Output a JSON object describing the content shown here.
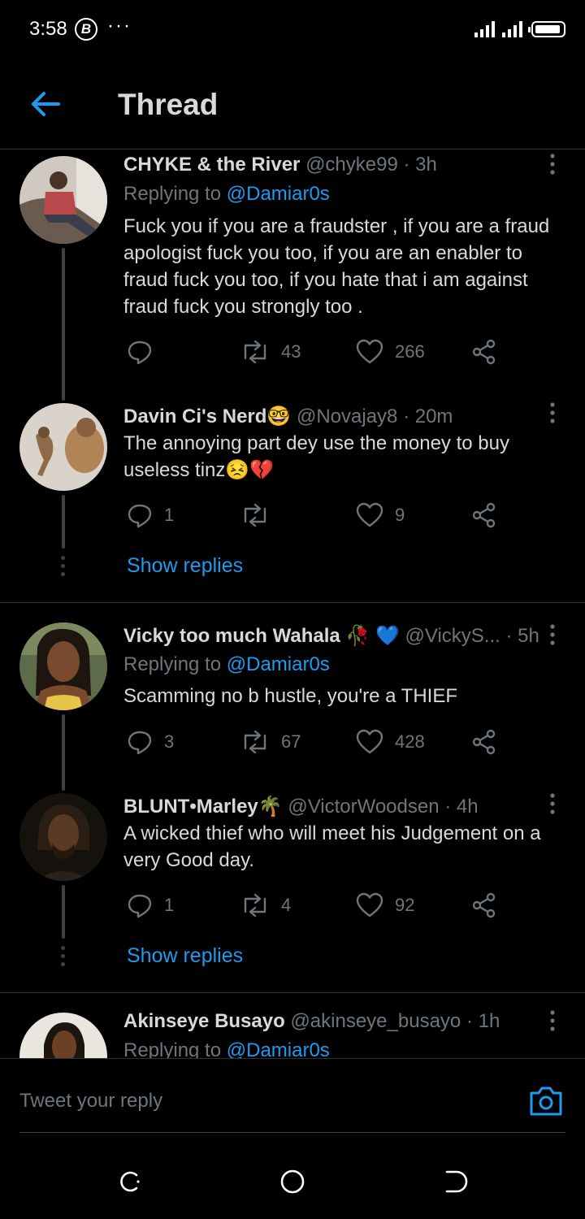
{
  "status_bar": {
    "time": "3:58",
    "app_badge": "B",
    "more": "···"
  },
  "header": {
    "title": "Thread"
  },
  "tweets": [
    {
      "name": "CHYKE & the River",
      "handle": "@chyke99",
      "time": "· 3h",
      "replying_label": "Replying to",
      "replying_to": "@Damiar0s",
      "text": "Fuck you if you are a fraudster , if you are a fraud apologist fuck you too, if you are an enabler to fraud fuck you too, if you hate that i am against fraud fuck you strongly too .",
      "replies": "",
      "retweets": "43",
      "likes": "266"
    },
    {
      "name": "Davin Ci's Nerd🤓",
      "handle": "@Novajay8",
      "time": "· 20m",
      "text": "The annoying part dey use the money to buy useless tinz😣💔",
      "replies": "1",
      "retweets": "",
      "likes": "9",
      "show_replies": "Show replies"
    },
    {
      "name": "Vicky too much Wahala 🥀 💙",
      "handle": "@VickyS...",
      "time": "· 5h",
      "replying_label": "Replying to",
      "replying_to": "@Damiar0s",
      "text": "Scamming no b hustle, you're a THIEF",
      "replies": "3",
      "retweets": "67",
      "likes": "428"
    },
    {
      "name": "BLUNT•Marley🌴",
      "handle": "@VictorWoodsen",
      "time": "· 4h",
      "text": "A wicked thief who will meet his Judgement on a very Good day.",
      "replies": "1",
      "retweets": "4",
      "likes": "92",
      "show_replies": "Show replies"
    },
    {
      "name": "Akinseye Busayo",
      "handle": "@akinseye_busayo",
      "time": "· 1h",
      "replying_label": "Replying to",
      "replying_to": "@Damiar0s"
    }
  ],
  "reply_bar": {
    "placeholder": "Tweet your reply"
  },
  "colors": {
    "accent": "#1d9bf0",
    "text": "#d9d9d9",
    "muted": "#6e767d",
    "divider": "#2f3336"
  }
}
